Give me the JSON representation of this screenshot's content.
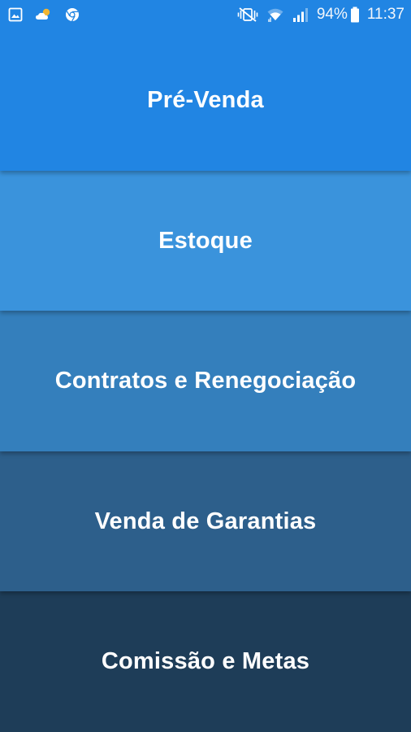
{
  "status_bar": {
    "left_icons": [
      "gallery-icon",
      "weather-icon",
      "chrome-icon"
    ],
    "right_icons": [
      "vibrate-mute-icon",
      "wifi-icon",
      "signal-icon",
      "battery-icon"
    ],
    "battery_percent": "94%",
    "time": "11:37"
  },
  "menu": {
    "items": [
      {
        "label": "Pré-Venda",
        "color": "#2185e3"
      },
      {
        "label": "Estoque",
        "color": "#3a93dc"
      },
      {
        "label": "Contratos e Renegociação",
        "color": "#347fbc"
      },
      {
        "label": "Venda de Garantias",
        "color": "#2d5f8b"
      },
      {
        "label": "Comissão e Metas",
        "color": "#1e3d58"
      }
    ]
  }
}
